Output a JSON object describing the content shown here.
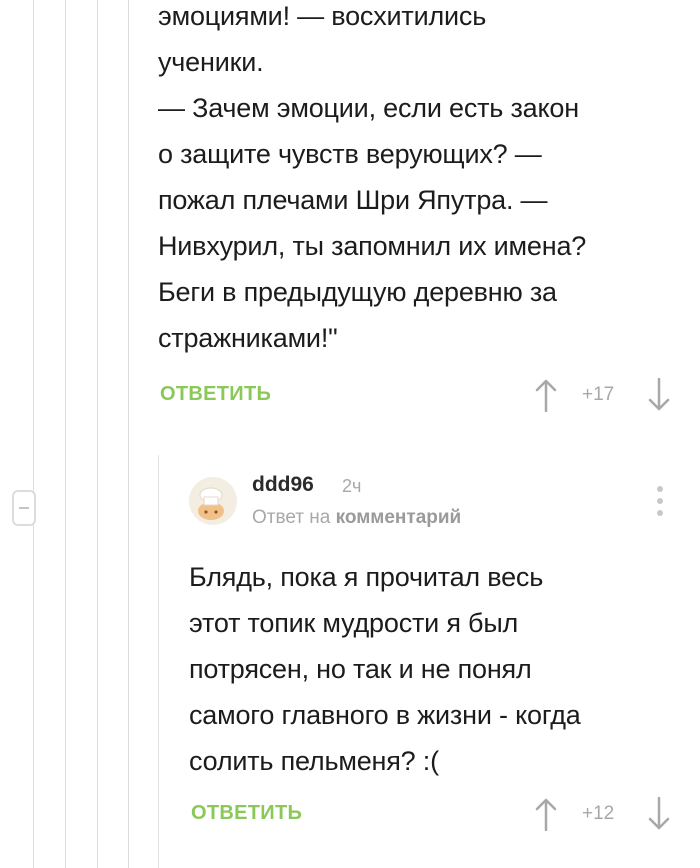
{
  "comment_parent": {
    "body_lines": [
      "эмоциями! — восхитились",
      "ученики.",
      "— Зачем эмоции, если есть закон",
      "о защите чувств верующих? —",
      "пожал плечами Шри Япутра. —",
      "Нивхурил, ты запомнил их имена?",
      "Беги в предыдущую деревню за",
      "стражниками!\""
    ],
    "reply_label": "ОТВЕТИТЬ",
    "rating": "+17"
  },
  "comment_reply": {
    "username": "ddd96",
    "time": "2ч",
    "reply_to_prefix": "Ответ на",
    "reply_to_link": "комментарий",
    "body_lines": [
      "Блядь, пока я прочитал весь",
      "этот топик мудрости я был",
      "потрясен, но так и не понял",
      "самого главного в жизни - когда",
      "солить пельменя? :("
    ],
    "reply_label": "ОТВЕТИТЬ",
    "rating": "+12"
  },
  "colors": {
    "accent_green": "#8ac858",
    "muted_gray": "#a8a8a8",
    "thread_line": "#dcdcdc"
  },
  "icons": [
    "collapse-minus-icon",
    "upvote-arrow-icon",
    "downvote-arrow-icon",
    "more-options-icon",
    "avatar-icon"
  ]
}
